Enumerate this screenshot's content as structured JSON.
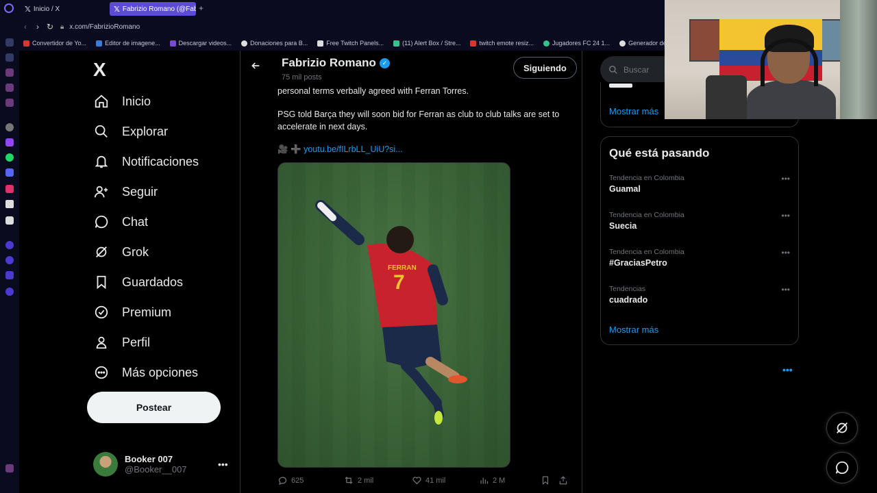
{
  "browser": {
    "tabs": [
      {
        "label": "Inicio / X",
        "active": false
      },
      {
        "label": "Fabrizio Romano (@Fabrizi",
        "active": true
      }
    ],
    "url": "x.com/FabrizioRomano",
    "bookmarks": [
      "Convertidor de Yo...",
      "Editor de imagene...",
      "Descargar videos...",
      "Donaciones para B...",
      "Free Twitch Panels...",
      "(11) Alert Box / Stre...",
      "twitch emote resiz...",
      "Jugadores FC 24 1...",
      "Generador de Voz..."
    ]
  },
  "nav": {
    "logo": "X",
    "items": [
      {
        "label": "Inicio",
        "icon": "home-icon"
      },
      {
        "label": "Explorar",
        "icon": "search-icon"
      },
      {
        "label": "Notificaciones",
        "icon": "bell-icon"
      },
      {
        "label": "Seguir",
        "icon": "person-plus-icon"
      },
      {
        "label": "Chat",
        "icon": "chat-icon"
      },
      {
        "label": "Grok",
        "icon": "grok-icon"
      },
      {
        "label": "Guardados",
        "icon": "bookmark-icon"
      },
      {
        "label": "Premium",
        "icon": "verified-badge-icon"
      },
      {
        "label": "Perfil",
        "icon": "person-icon"
      },
      {
        "label": "Más opciones",
        "icon": "more-circle-icon"
      }
    ],
    "post_button": "Postear",
    "user": {
      "name": "Booker 007",
      "handle": "@Booker__007"
    }
  },
  "profile": {
    "name": "Fabrizio Romano",
    "posts": "75 mil posts",
    "follow_label": "Siguiendo"
  },
  "tweet": {
    "line1": "personal terms verbally agreed with Ferran Torres.",
    "line2": "PSG told Barça they will soon bid for Ferran as club to club talks are set to accelerate in next days.",
    "link_emoji": "🎥 ➕",
    "link": "youtu.be/fILrbLL_UiU?si...",
    "image_jersey_name": "FERRAN",
    "image_jersey_number": "7",
    "stats": {
      "replies": "625",
      "reposts": "2 mil",
      "likes": "41 mil",
      "views": "2 M"
    }
  },
  "right": {
    "search_placeholder": "Buscar",
    "show_more_top": "Mostrar más",
    "trends_title": "Qué está pasando",
    "trends": [
      {
        "context": "Tendencia en Colombia",
        "name": "Guamal"
      },
      {
        "context": "Tendencia en Colombia",
        "name": "Suecia"
      },
      {
        "context": "Tendencia en Colombia",
        "name": "#GraciasPetro"
      },
      {
        "context": "Tendencias",
        "name": "cuadrado"
      }
    ],
    "show_more_bottom": "Mostrar más"
  },
  "colors": {
    "accent": "#1d9bf0",
    "background": "#000000",
    "opera_tab": "#5c4bd6"
  }
}
